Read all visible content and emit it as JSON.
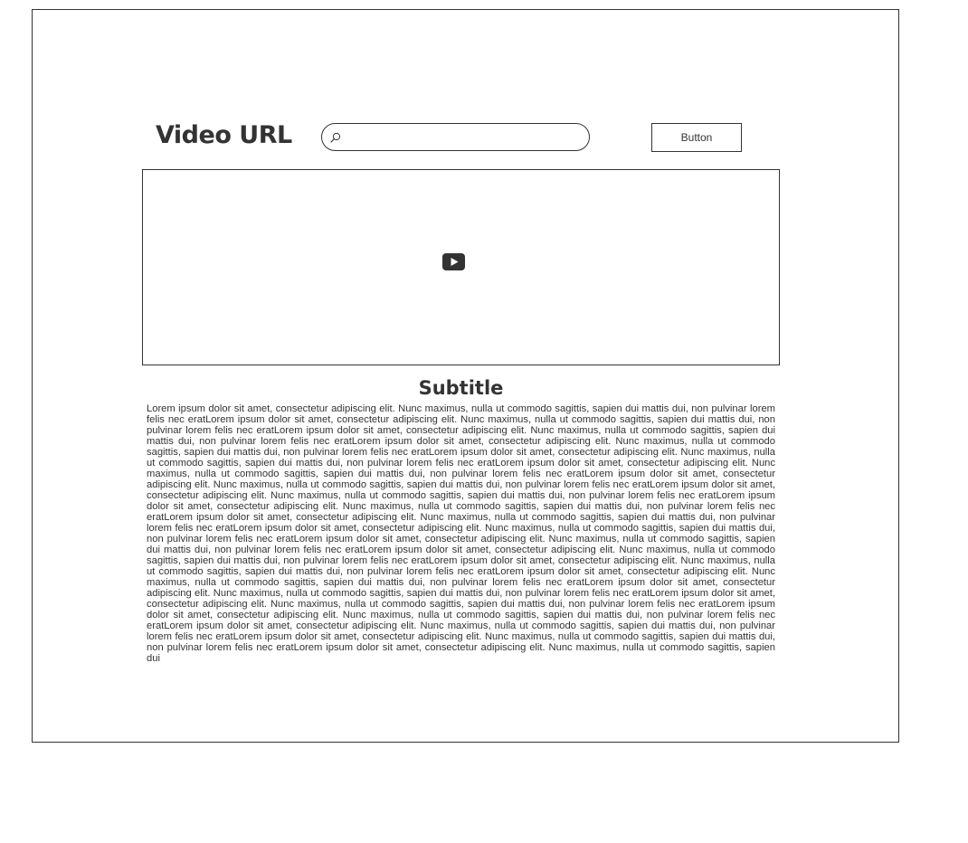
{
  "header": {
    "title": "Video URL",
    "search": {
      "value": "",
      "placeholder": ""
    },
    "button_label": "Button"
  },
  "video": {
    "icon": "play-icon"
  },
  "content": {
    "subtitle": "Subtitle",
    "body": "Lorem ipsum dolor sit amet, consectetur adipiscing elit. Nunc maximus, nulla ut commodo sagittis, sapien dui mattis dui, non pulvinar lorem felis nec eratLorem ipsum dolor sit amet, consectetur adipiscing elit. Nunc maximus, nulla ut commodo sagittis, sapien dui mattis dui, non pulvinar lorem felis nec eratLorem ipsum dolor sit amet, consectetur adipiscing elit. Nunc maximus, nulla ut commodo sagittis, sapien dui mattis dui, non pulvinar lorem felis nec eratLorem ipsum dolor sit amet, consectetur adipiscing elit. Nunc maximus, nulla ut commodo sagittis, sapien dui mattis dui, non pulvinar lorem felis nec eratLorem ipsum dolor sit amet, consectetur adipiscing elit. Nunc maximus, nulla ut commodo sagittis, sapien dui mattis dui, non pulvinar lorem felis nec eratLorem ipsum dolor sit amet, consectetur adipiscing elit. Nunc maximus, nulla ut commodo sagittis, sapien dui mattis dui, non pulvinar lorem felis nec eratLorem ipsum dolor sit amet, consectetur adipiscing elit. Nunc maximus, nulla ut commodo sagittis, sapien dui mattis dui, non pulvinar lorem felis nec eratLorem ipsum dolor sit amet, consectetur adipiscing elit. Nunc maximus, nulla ut commodo sagittis, sapien dui mattis dui, non pulvinar lorem felis nec eratLorem ipsum dolor sit amet, consectetur adipiscing elit. Nunc maximus, nulla ut commodo sagittis, sapien dui mattis dui, non pulvinar lorem felis nec eratLorem ipsum dolor sit amet, consectetur adipiscing elit. Nunc maximus, nulla ut commodo sagittis, sapien dui mattis dui, non pulvinar lorem felis nec eratLorem ipsum dolor sit amet, consectetur adipiscing elit. Nunc maximus, nulla ut commodo sagittis, sapien dui mattis dui, non pulvinar lorem felis nec eratLorem ipsum dolor sit amet, consectetur adipiscing elit. Nunc maximus, nulla ut commodo sagittis, sapien dui mattis dui, non pulvinar lorem felis nec eratLorem ipsum dolor sit amet, consectetur adipiscing elit. Nunc maximus, nulla ut commodo sagittis, sapien dui mattis dui, non pulvinar lorem felis nec eratLorem ipsum dolor sit amet, consectetur adipiscing elit. Nunc maximus, nulla ut commodo sagittis, sapien dui mattis dui, non pulvinar lorem felis nec eratLorem ipsum dolor sit amet, consectetur adipiscing elit. Nunc maximus, nulla ut commodo sagittis, sapien dui mattis dui, non pulvinar lorem felis nec eratLorem ipsum dolor sit amet, consectetur adipiscing elit. Nunc maximus, nulla ut commodo sagittis, sapien dui mattis dui, non pulvinar lorem felis nec eratLorem ipsum dolor sit amet, consectetur adipiscing elit. Nunc maximus, nulla ut commodo sagittis, sapien dui mattis dui, non pulvinar lorem felis nec eratLorem ipsum dolor sit amet, consectetur adipiscing elit. Nunc maximus, nulla ut commodo sagittis, sapien dui mattis dui, non pulvinar lorem felis nec eratLorem ipsum dolor sit amet, consectetur adipiscing elit. Nunc maximus, nulla ut commodo sagittis, sapien dui mattis dui, non pulvinar lorem felis nec eratLorem ipsum dolor sit amet, consectetur adipiscing elit. Nunc maximus, nulla ut commodo sagittis, sapien dui mattis dui, non pulvinar lorem felis nec eratLorem ipsum dolor sit amet, consectetur adipiscing elit. Nunc maximus, nulla ut commodo sagittis, sapien dui"
  },
  "colors": {
    "stroke": "#333333",
    "background": "#ffffff"
  }
}
